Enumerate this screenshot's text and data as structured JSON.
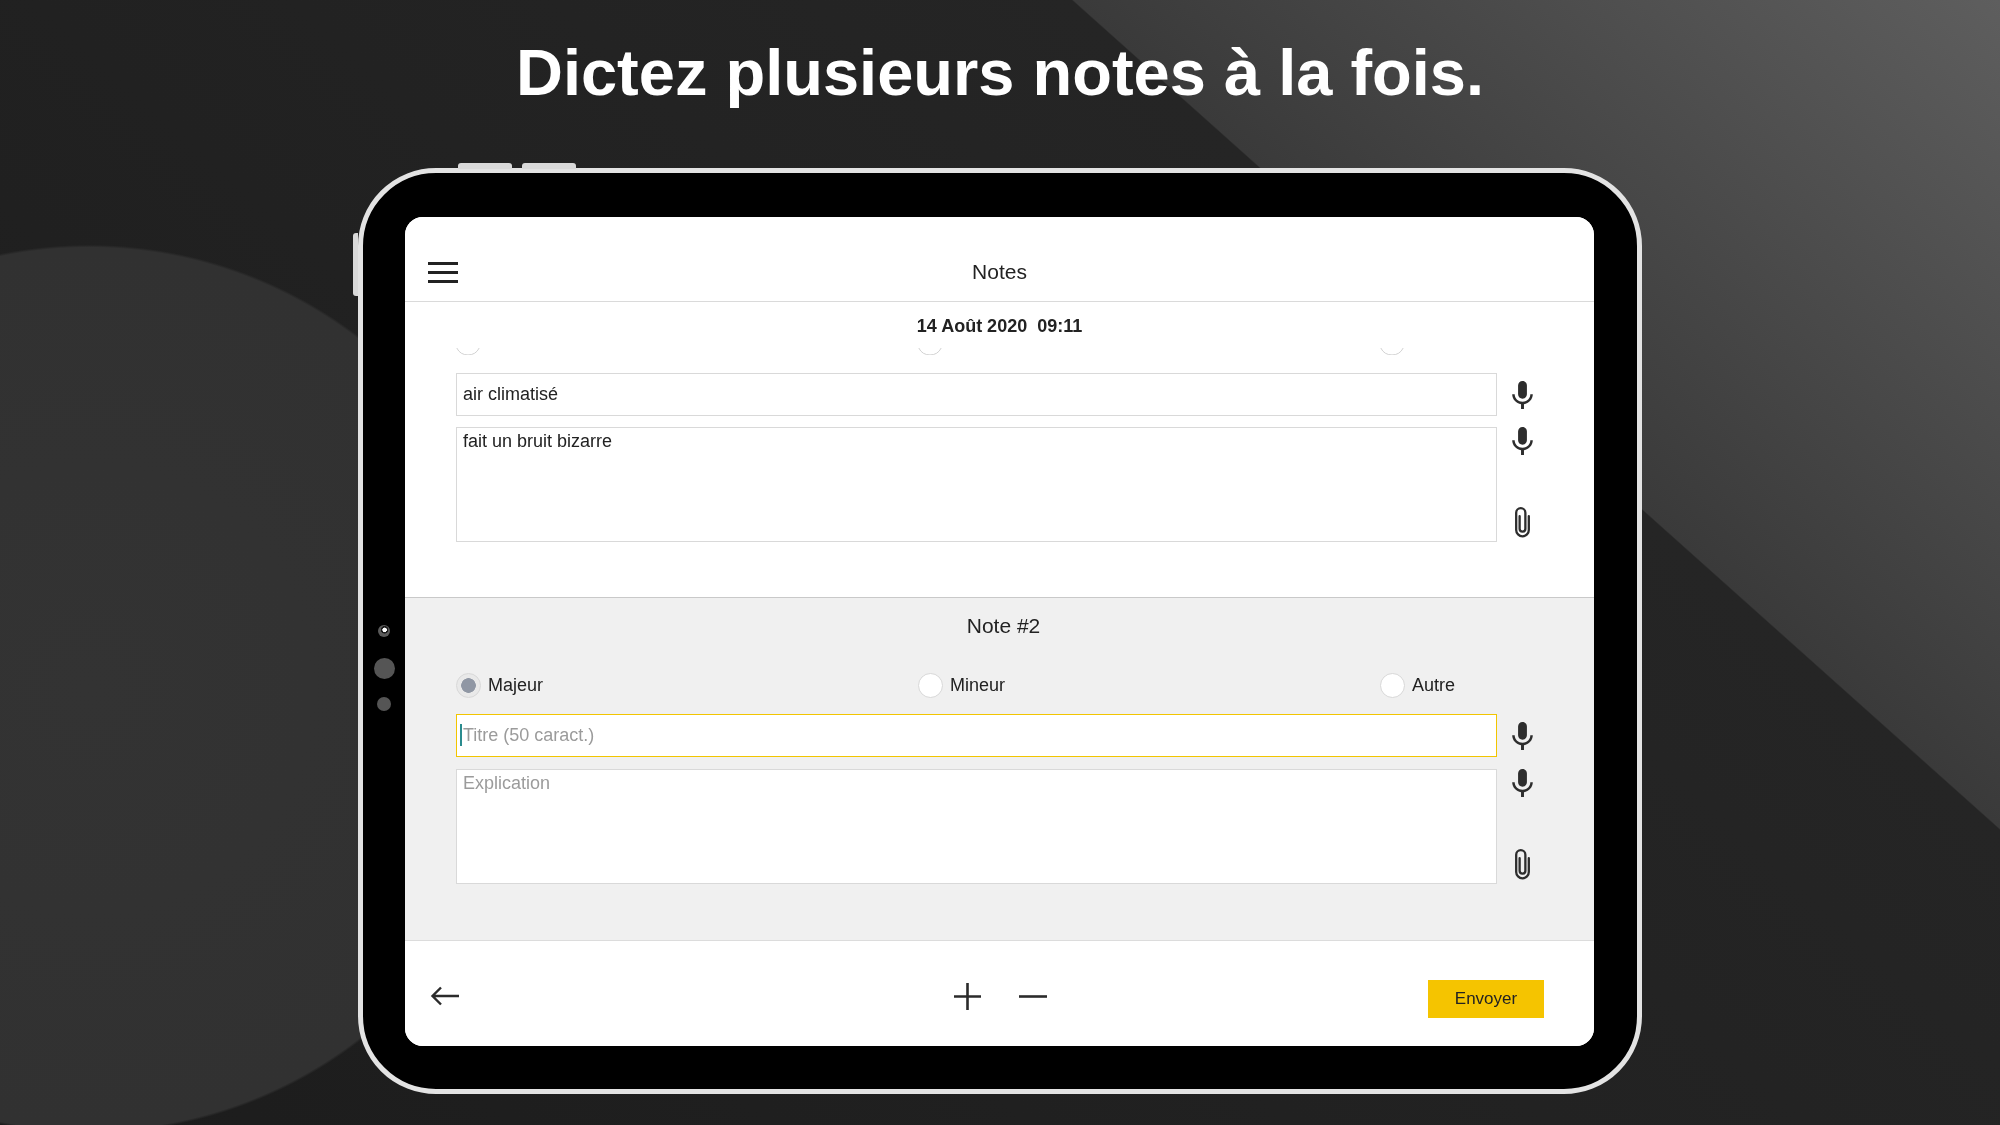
{
  "headline": "Dictez plusieurs notes à la fois.",
  "app_bar": {
    "title": "Notes"
  },
  "timestamp": {
    "date": "14 Août 2020",
    "time": "09:11"
  },
  "notes": [
    {
      "kind": "scrolled",
      "active": false,
      "title_field": {
        "value": "air climatisé",
        "focused": false
      },
      "explication_field": {
        "value": "fait un bruit bizarre",
        "focused": false
      }
    },
    {
      "kind": "full",
      "active": true,
      "heading": "Note #2",
      "options": [
        {
          "label": "Majeur",
          "selected": true
        },
        {
          "label": "Mineur",
          "selected": false
        },
        {
          "label": "Autre",
          "selected": false
        }
      ],
      "title_field": {
        "placeholder": "Titre (50 caract.)",
        "focused": true
      },
      "explication_field": {
        "placeholder": "Explication",
        "focused": false
      }
    }
  ],
  "bottom_bar": {
    "send_button": "Envoyer"
  }
}
